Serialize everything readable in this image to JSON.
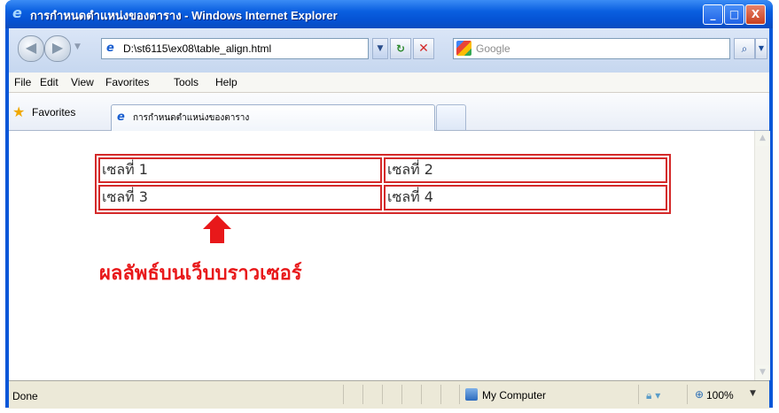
{
  "window": {
    "title": "การกำหนดตำแหน่งของตาราง - Windows Internet Explorer",
    "min": "_",
    "max": "□",
    "close": "X"
  },
  "address": {
    "url": "D:\\st6115\\ex08\\table_align.html"
  },
  "search": {
    "placeholder": "Google"
  },
  "menu": [
    "File",
    "Edit",
    "View",
    "Favorites",
    "Tools",
    "Help"
  ],
  "favorites": {
    "label": "Favorites"
  },
  "tab": {
    "label": "การกำหนดตำแหน่งของตาราง"
  },
  "table": {
    "rows": [
      [
        "เซลที่ 1",
        "เซลที่ 2"
      ],
      [
        "เซลที่ 3",
        "เซลที่ 4"
      ]
    ]
  },
  "caption": "ผลลัพธ์บนเว็บบราวเซอร์",
  "status": {
    "text": "Done",
    "zone": "My Computer",
    "zoom": "100%"
  }
}
